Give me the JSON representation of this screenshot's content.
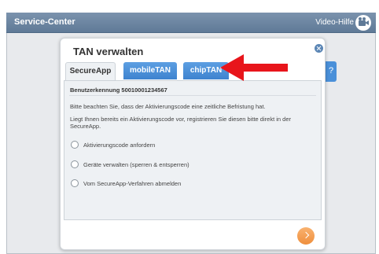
{
  "header": {
    "title": "Service-Center",
    "video_label": "Video-Hilfe"
  },
  "underlay": {
    "help_label": "?"
  },
  "modal": {
    "title": "TAN verwalten",
    "tabs": [
      {
        "label": "SecureApp",
        "active": true
      },
      {
        "label": "mobileTAN",
        "active": false
      },
      {
        "label": "chipTAN",
        "active": false
      }
    ],
    "user_id": "Benutzerkennung 50010001234567",
    "notice": "Bitte beachten Sie, dass der Aktivierungscode eine zeitliche Befristung hat.",
    "instruction_line1": "Liegt Ihnen bereits ein Aktivierungscode vor, registrieren Sie diesen bitte direkt in der",
    "instruction_line2": "SecureApp.",
    "options": [
      {
        "label": "Aktivierungscode anfordern"
      },
      {
        "label": "Geräte verwalten (sperren & entsperren)"
      },
      {
        "label": "Vom SecureApp-Verfahren abmelden"
      }
    ]
  },
  "colors": {
    "accent_blue": "#3e83cf",
    "header_bg": "#6f88a4",
    "next_orange": "#ef8f3d",
    "annotation_red": "#e8151b"
  }
}
